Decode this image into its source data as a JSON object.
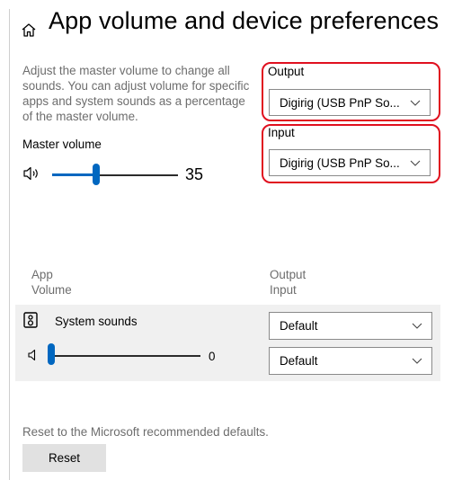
{
  "header": {
    "title": "App volume and device preferences",
    "home_icon": "home-icon"
  },
  "master": {
    "description": "Adjust the master volume to change all sounds. You can adjust volume for specific apps and system sounds as a percentage of the master volume.",
    "label": "Master volume",
    "value": "35",
    "level_percent": 35,
    "icon": "speaker-icon"
  },
  "devices": {
    "output_label": "Output",
    "output_value": "Digirig (USB PnP So...",
    "input_label": "Input",
    "input_value": "Digirig (USB PnP So..."
  },
  "apps": {
    "col_app": "App",
    "col_volume": "Volume",
    "col_output": "Output",
    "col_input": "Input",
    "items": [
      {
        "name": "System sounds",
        "value": "0",
        "level_percent": 0,
        "output": "Default",
        "input": "Default"
      }
    ]
  },
  "reset": {
    "description": "Reset to the Microsoft recommended defaults.",
    "button_label": "Reset"
  },
  "colors": {
    "accent": "#0067c0",
    "highlight": "#e0101f",
    "panel": "#f0f0f0"
  }
}
